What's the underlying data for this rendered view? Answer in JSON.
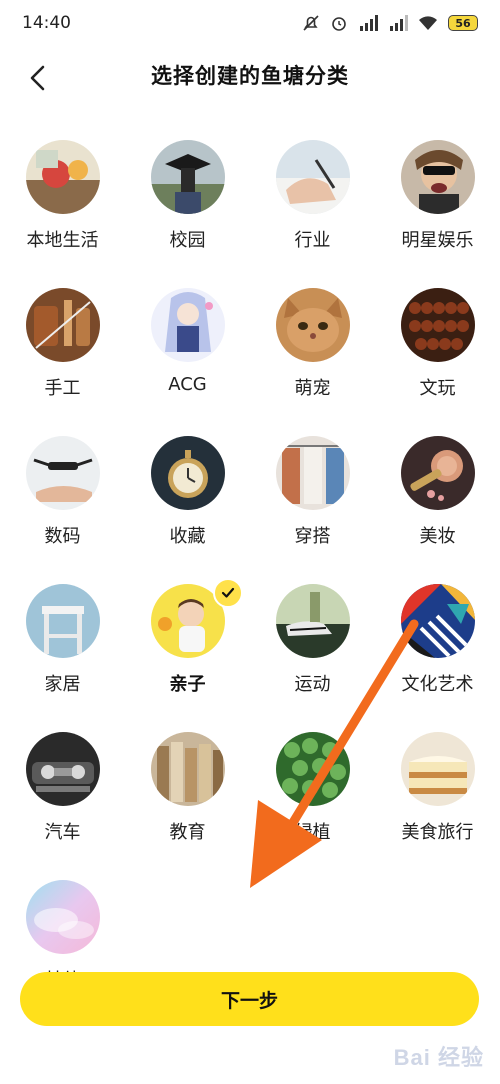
{
  "status": {
    "time": "14:40",
    "battery": "56"
  },
  "header": {
    "title": "选择创建的鱼塘分类"
  },
  "categories": [
    {
      "label": "本地生活",
      "selected": false
    },
    {
      "label": "校园",
      "selected": false
    },
    {
      "label": "行业",
      "selected": false
    },
    {
      "label": "明星娱乐",
      "selected": false
    },
    {
      "label": "手工",
      "selected": false
    },
    {
      "label": "ACG",
      "selected": false
    },
    {
      "label": "萌宠",
      "selected": false
    },
    {
      "label": "文玩",
      "selected": false
    },
    {
      "label": "数码",
      "selected": false
    },
    {
      "label": "收藏",
      "selected": false
    },
    {
      "label": "穿搭",
      "selected": false
    },
    {
      "label": "美妆",
      "selected": false
    },
    {
      "label": "家居",
      "selected": false
    },
    {
      "label": "亲子",
      "selected": true
    },
    {
      "label": "运动",
      "selected": false
    },
    {
      "label": "文化艺术",
      "selected": false
    },
    {
      "label": "汽车",
      "selected": false
    },
    {
      "label": "教育",
      "selected": false
    },
    {
      "label": "绿植",
      "selected": false
    },
    {
      "label": "美食旅行",
      "selected": false
    },
    {
      "label": "其他",
      "selected": false
    }
  ],
  "footer": {
    "next_label": "下一步"
  },
  "watermark": "Bai 经验",
  "colors": {
    "accent": "#ffe01b",
    "annotation_arrow": "#f26b1d"
  }
}
